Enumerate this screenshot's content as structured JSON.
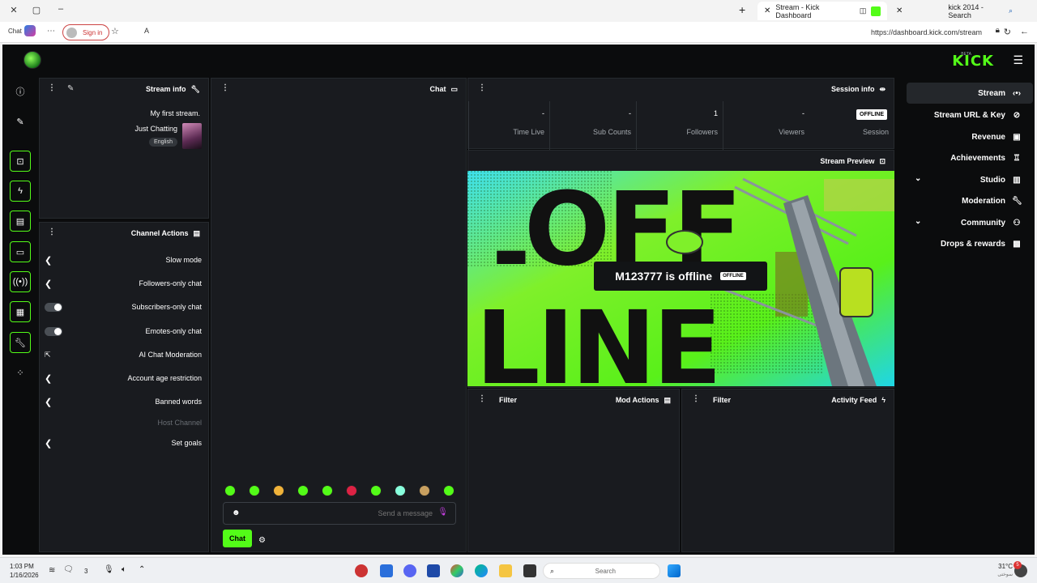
{
  "browser": {
    "tabs": [
      {
        "title": "kick 2014 - Search"
      },
      {
        "title": "Stream - Kick Dashboard"
      }
    ],
    "url": "https://dashboard.kick.com/stream",
    "signin_label": "Sign in",
    "chat_label": "Chat"
  },
  "app": {
    "logo": "KICK",
    "logo_beta": "BETA",
    "side_nav": [
      {
        "label": "Stream",
        "icon": "broadcast-icon",
        "active": true
      },
      {
        "label": "Stream URL & Key",
        "icon": "link-icon"
      },
      {
        "label": "Revenue",
        "icon": "revenue-icon"
      },
      {
        "label": "Achievements",
        "icon": "trophy-icon"
      },
      {
        "label": "Studio",
        "icon": "studio-icon",
        "expandable": true
      },
      {
        "label": "Moderation",
        "icon": "wrench-icon"
      },
      {
        "label": "Community",
        "icon": "community-icon",
        "expandable": true
      },
      {
        "label": "Drops & rewards",
        "icon": "gift-icon"
      }
    ],
    "session_info": {
      "title": "Session info",
      "status": "OFFLINE",
      "stats": [
        {
          "label": "Session",
          "value": ""
        },
        {
          "label": "Viewers",
          "value": "-"
        },
        {
          "label": "Followers",
          "value": "1"
        },
        {
          "label": "Sub Counts",
          "value": "-"
        },
        {
          "label": "Time Live",
          "value": "-"
        }
      ]
    },
    "stream_info": {
      "title": "Stream info",
      "stream_title": "My first stream.",
      "category": "Just Chatting",
      "language": "English"
    },
    "chat": {
      "title": "Chat",
      "placeholder": "Send a message",
      "send_label": "Chat"
    },
    "channel_actions": {
      "title": "Channel Actions",
      "items": [
        {
          "label": "Slow mode",
          "control": "chevron"
        },
        {
          "label": "Followers-only chat",
          "control": "chevron"
        },
        {
          "label": "Subscribers-only chat",
          "control": "toggle"
        },
        {
          "label": "Emotes-only chat",
          "control": "toggle"
        },
        {
          "label": "AI Chat Moderation",
          "control": "external"
        },
        {
          "label": "Account age restriction",
          "control": "chevron"
        },
        {
          "label": "Banned words",
          "control": "chevron"
        },
        {
          "label": "Host Channel",
          "control": "none",
          "disabled": true
        },
        {
          "label": "Set goals",
          "control": "chevron"
        }
      ]
    },
    "stream_preview": {
      "title": "Stream Preview",
      "offline_text": "M123777 is offline",
      "badge": "OFFLINE",
      "art_text_top": "OFF-",
      "art_text_bottom": "LINE"
    },
    "activity_feed": {
      "title": "Activity Feed",
      "filter_label": "Filter"
    },
    "mod_actions": {
      "title": "Mod Actions",
      "filter_label": "Filter"
    }
  },
  "taskbar": {
    "time": "1:03 PM",
    "date": "1/16/2026",
    "search_placeholder": "Search",
    "weather": "31°C",
    "weather_sub": "سوختی",
    "notif_count": "3",
    "news_badge": "5"
  }
}
